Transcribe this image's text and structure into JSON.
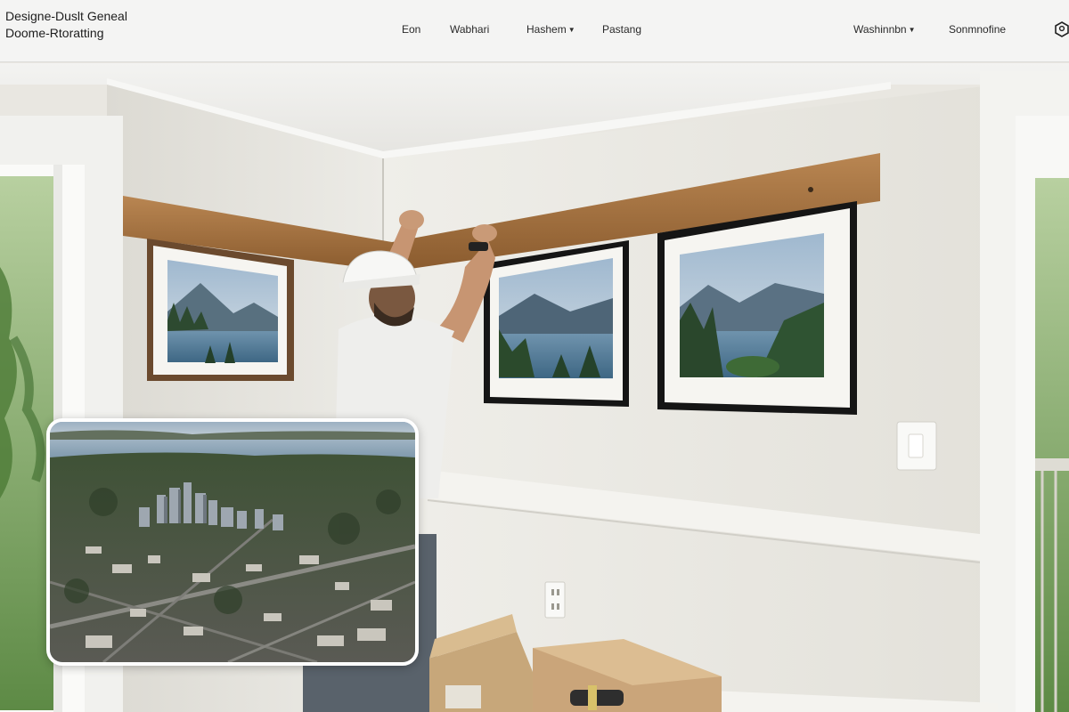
{
  "header": {
    "logo_line1": "Designe-Duslt Geneal",
    "logo_line2": "Doome-Rtoratting",
    "nav": [
      {
        "label": "Eon",
        "dropdown": false
      },
      {
        "label": "Wabhari",
        "dropdown": false
      },
      {
        "label": "Hashem",
        "dropdown": true
      },
      {
        "label": "Pastang",
        "dropdown": false
      },
      {
        "label": "Washinnbn",
        "dropdown": true
      },
      {
        "label": "Sonmnofine",
        "dropdown": false
      }
    ],
    "right_icon": "user-profile-icon"
  },
  "hero": {
    "scene": "worker-installing-picture-rail",
    "frames": [
      "mountain-lake-print",
      "mountain-lake-print",
      "mountain-lake-print"
    ]
  },
  "inset": {
    "scene": "aerial-city-waterfront"
  },
  "colors": {
    "header_bg": "#f4f4f3",
    "wall": "#e8e6e0",
    "wood_rail": "#9a6a3b",
    "inset_border": "#ffffff"
  }
}
